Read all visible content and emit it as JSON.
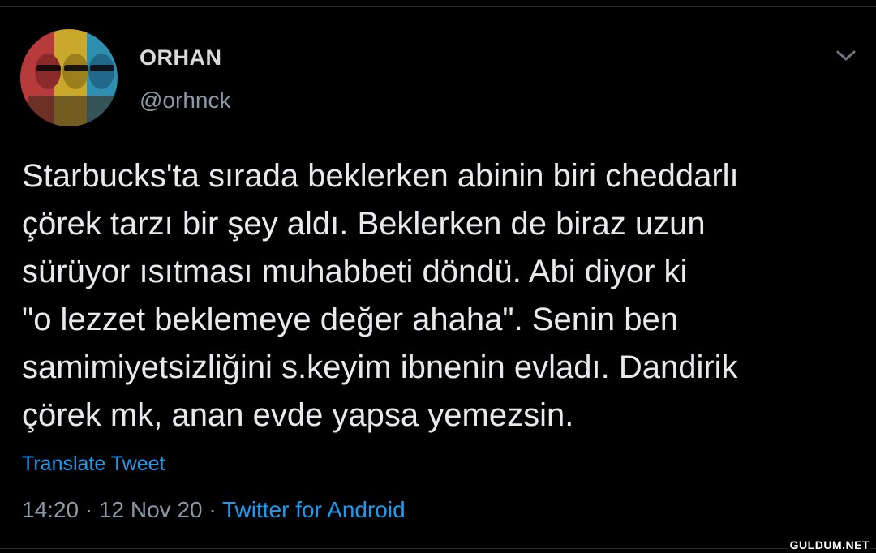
{
  "tweet": {
    "display_name": "ORHAN",
    "handle": "@orhnck",
    "text_lines": [
      "Starbucks'ta sırada beklerken abinin biri cheddarlı",
      "çörek tarzı bir şey aldı. Beklerken de biraz uzun",
      "sürüyor ısıtması muhabbeti döndü. Abi diyor ki",
      "\"o lezzet beklemeye değer ahaha\". Senin ben",
      "samimiyetsizliğini s.keyim ibnenin evladı. Dandirik",
      "çörek mk, anan evde yapsa yemezsin."
    ],
    "translate_label": "Translate Tweet",
    "time": "14:20",
    "separator": "·",
    "date": "12 Nov 20",
    "source": "Twitter for Android"
  },
  "icons": {
    "avatar": "avatar-image",
    "more": "chevron-down-icon"
  },
  "colors": {
    "background": "#000000",
    "text": "#e7e9ea",
    "secondary": "#8b98a5",
    "link": "#1d9bf0"
  },
  "watermark": "GULDUM.NET"
}
